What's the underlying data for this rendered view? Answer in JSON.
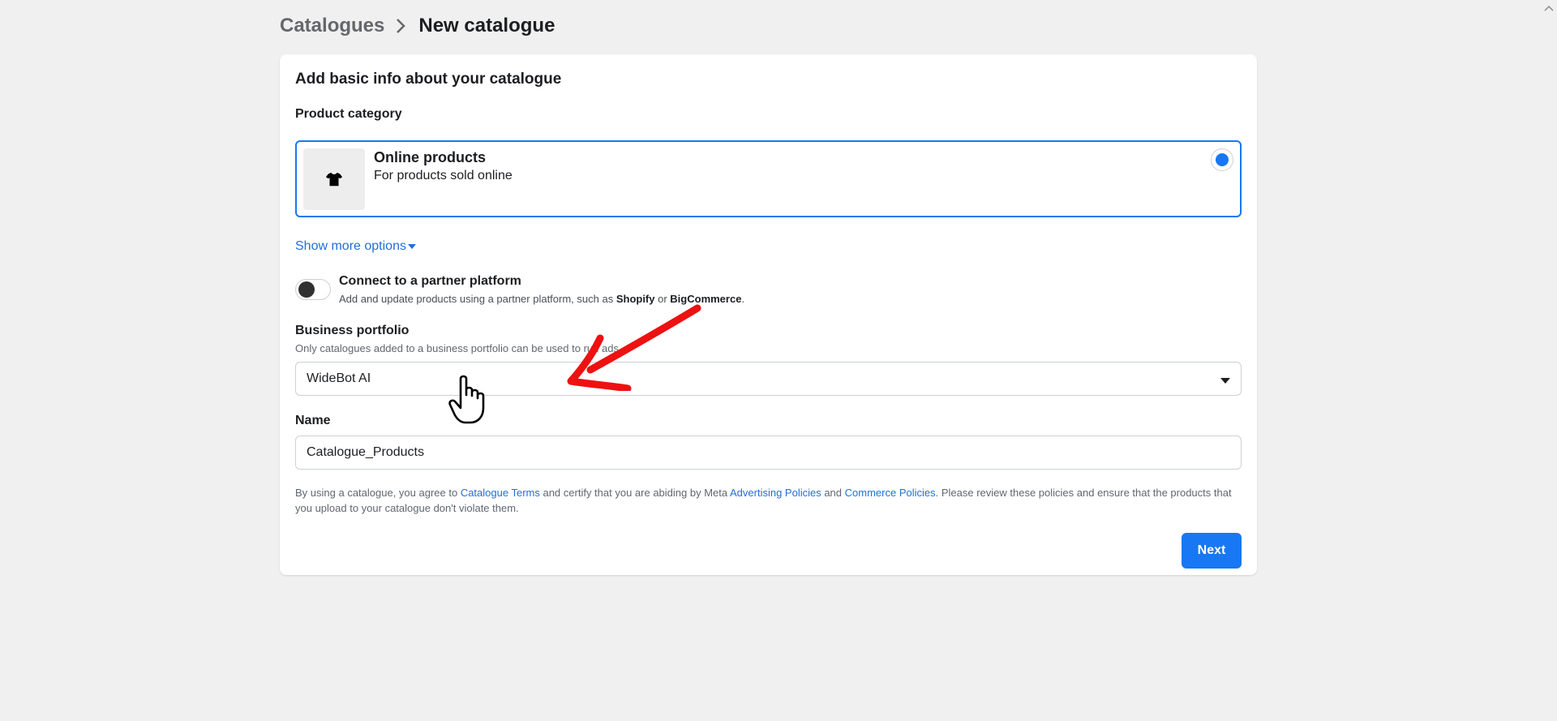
{
  "breadcrumb": {
    "parent": "Catalogues",
    "current": "New catalogue"
  },
  "card": {
    "title": "Add basic info about your catalogue",
    "product_category": {
      "label": "Product category",
      "option": {
        "title": "Online products",
        "subtitle": "For products sold online",
        "icon": "t-shirt-icon",
        "selected": true
      },
      "show_more": "Show more options"
    },
    "partner": {
      "title": "Connect to a partner platform",
      "desc_prefix": "Add and update products using a partner platform, such as ",
      "platform_1": "Shopify",
      "desc_or": " or ",
      "platform_2": "BigCommerce",
      "desc_suffix": ".",
      "enabled": false
    },
    "business_portfolio": {
      "label": "Business portfolio",
      "hint": "Only catalogues added to a business portfolio can be used to run ads.",
      "selected": "WideBot AI"
    },
    "name": {
      "label": "Name",
      "value": "Catalogue_Products"
    },
    "terms": {
      "t1": "By using a catalogue, you agree to ",
      "link1": "Catalogue Terms",
      "t2": " and certify that you are abiding by Meta ",
      "link2": "Advertising Policies",
      "t3": " and ",
      "link3": "Commerce Policies",
      "t4": ". Please review these policies and ensure that the products that you upload to your catalogue don't violate them."
    },
    "next_label": "Next"
  },
  "colors": {
    "accent": "#1877f2",
    "link": "#216fdb",
    "background": "#f0f0f0",
    "annotation_arrow": "#ee1111"
  }
}
